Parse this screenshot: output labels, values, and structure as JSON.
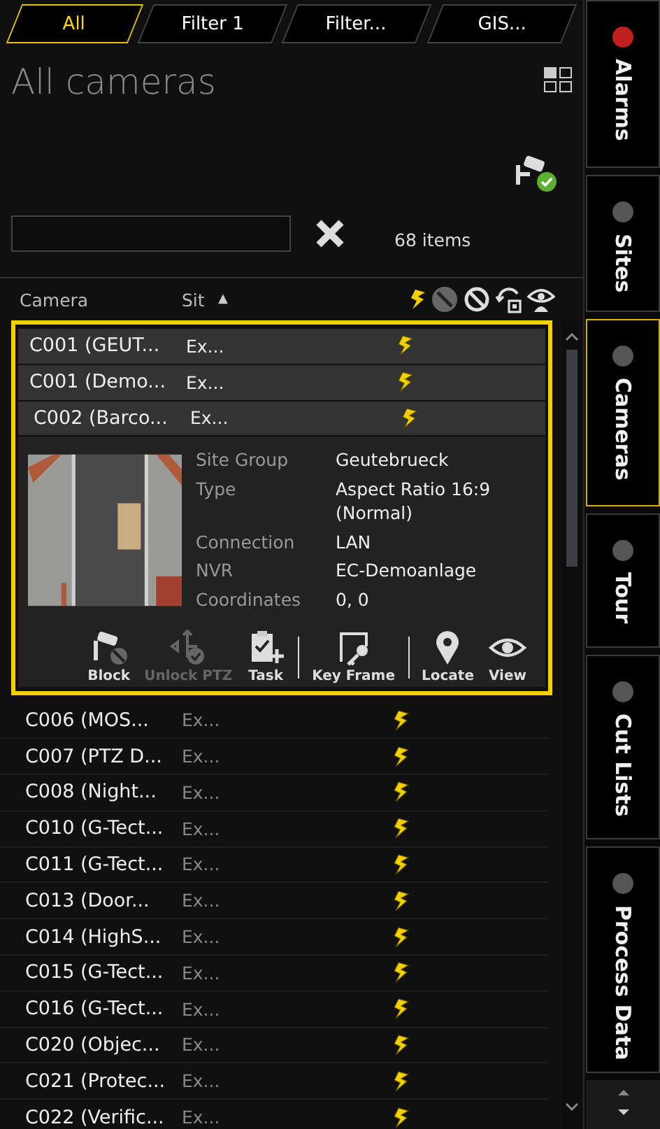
{
  "tabs": [
    {
      "label": "All",
      "selected": true
    },
    {
      "label": "Filter 1",
      "selected": false
    },
    {
      "label": "Filter...",
      "selected": false
    },
    {
      "label": "GIS...",
      "selected": false
    }
  ],
  "title": "All cameras",
  "item_count": "68 items",
  "columns": {
    "camera": "Camera",
    "site": "Sit",
    "sort": "▲"
  },
  "rows": [
    {
      "name": "C001  (GEUT...",
      "site": "Ex...",
      "selected": true
    },
    {
      "name": "C001  (Demo...",
      "site": "Ex...",
      "selected": true
    },
    {
      "name": "C002  (Barco...",
      "site": "Ex...",
      "selected": true,
      "details": {
        "fields": [
          {
            "label": "Site Group",
            "value": "Geutebrueck"
          },
          {
            "label": "Type",
            "value": "Aspect Ratio 16:9 (Normal)"
          },
          {
            "label": "Connection",
            "value": "LAN"
          },
          {
            "label": "NVR",
            "value": "EC-Demoanlage"
          },
          {
            "label": "Coordinates",
            "value": "0, 0"
          }
        ],
        "actions": [
          {
            "kind": "block",
            "label": "Block",
            "disabled": false,
            "separator_after": false
          },
          {
            "kind": "ptz",
            "label": "Unlock PTZ",
            "disabled": true,
            "separator_after": false
          },
          {
            "kind": "task",
            "label": "Task",
            "disabled": false,
            "separator_after": true
          },
          {
            "kind": "keyframe",
            "label": "Key Frame",
            "disabled": false,
            "separator_after": true
          },
          {
            "kind": "locate",
            "label": "Locate",
            "disabled": false,
            "separator_after": false
          },
          {
            "kind": "view",
            "label": "View",
            "disabled": false,
            "separator_after": false
          }
        ]
      }
    },
    {
      "name": "C006  (MOS...",
      "site": "Ex...",
      "selected": false
    },
    {
      "name": "C007  (PTZ  D...",
      "site": "Ex...",
      "selected": false
    },
    {
      "name": "C008  (Night...",
      "site": "Ex...",
      "selected": false
    },
    {
      "name": "C010  (G-Tect...",
      "site": "Ex...",
      "selected": false
    },
    {
      "name": "C011  (G-Tect...",
      "site": "Ex...",
      "selected": false
    },
    {
      "name": "C013  (Door...",
      "site": "Ex...",
      "selected": false
    },
    {
      "name": "C014  (HighS...",
      "site": "Ex...",
      "selected": false
    },
    {
      "name": "C015  (G-Tect...",
      "site": "Ex...",
      "selected": false
    },
    {
      "name": "C016  (G-Tect...",
      "site": "Ex...",
      "selected": false
    },
    {
      "name": "C020  (Objec...",
      "site": "Ex...",
      "selected": false
    },
    {
      "name": "C021  (Protec...",
      "site": "Ex...",
      "selected": false
    },
    {
      "name": "C022  (Verific...",
      "site": "Ex...",
      "selected": false
    }
  ],
  "side_tabs": [
    {
      "label": "Alarms",
      "selected": false,
      "color": "#c02020"
    },
    {
      "label": "Sites",
      "selected": false,
      "color": "#555555"
    },
    {
      "label": "Cameras",
      "selected": true,
      "color": "#555555"
    },
    {
      "label": "Tour",
      "selected": false,
      "color": "#555555"
    },
    {
      "label": "Cut Lists",
      "selected": false,
      "color": "#555555"
    },
    {
      "label": "Process Data",
      "selected": false,
      "color": "#555555"
    }
  ]
}
